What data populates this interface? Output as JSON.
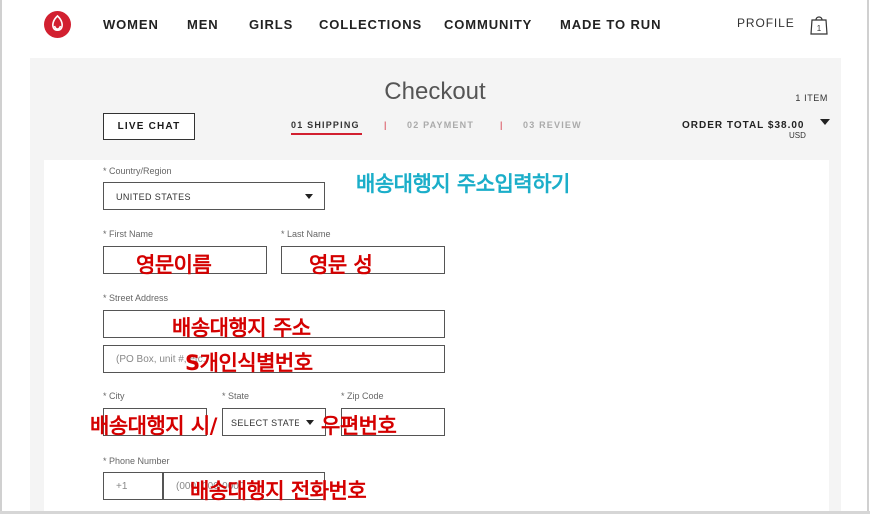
{
  "header": {
    "nav": [
      "WOMEN",
      "MEN",
      "GIRLS",
      "COLLECTIONS",
      "COMMUNITY",
      "MADE TO RUN"
    ],
    "profile_label": "PROFILE",
    "bag_count": "1"
  },
  "checkout": {
    "title": "Checkout",
    "items_count": "1 ITEM",
    "live_chat_label": "LIVE CHAT",
    "steps": [
      "01 SHIPPING",
      "02 PAYMENT",
      "03 REVIEW"
    ],
    "active_step": "01 SHIPPING",
    "order_total_label": "ORDER TOTAL $38.00",
    "currency": "USD"
  },
  "form": {
    "country_label": "* Country/Region",
    "country_value": "UNITED STATES",
    "first_name_label": "* First Name",
    "last_name_label": "* Last Name",
    "street_label": "* Street Address",
    "street2_placeholder": "(PO Box, unit #, etc.)",
    "city_label": "* City",
    "state_label": "* State",
    "state_value": "SELECT STATE",
    "zip_label": "* Zip Code",
    "phone_label": "* Phone Number",
    "phone_prefix": "+1",
    "phone_placeholder": "(000) 000-0000"
  },
  "annotations": {
    "title": "배송대행지 주소입력하기",
    "first_name": "영문이름",
    "last_name": "영문 성",
    "street": "배송대행지 주소",
    "street2": "S개인식별번호",
    "city": "배송대행지 시/",
    "zip": "우편번호",
    "phone": "배송대행지 전화번호"
  },
  "colors": {
    "brand_red": "#d22030",
    "annotation_red": "#d40000",
    "annotation_blue": "#1baec9",
    "panel_gray": "#f4f4f4"
  },
  "icons": [
    "lululemon-logo-icon",
    "shopping-bag-icon",
    "chevron-down-icon"
  ]
}
